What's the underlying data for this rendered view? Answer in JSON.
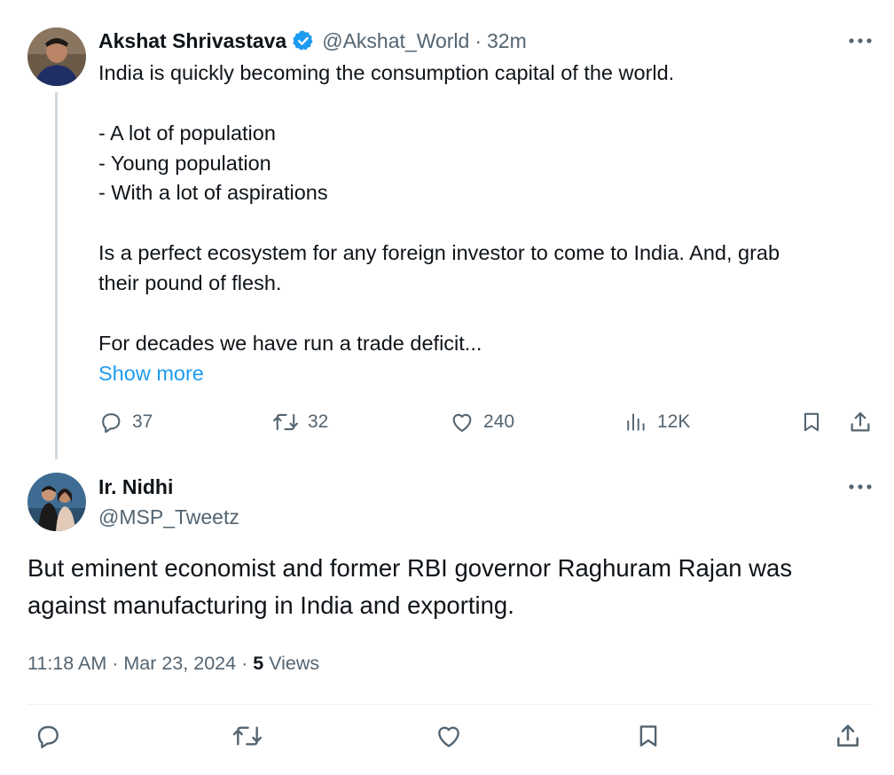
{
  "parent_tweet": {
    "author_name": "Akshat Shrivastava",
    "handle": "@Akshat_World",
    "separator": "·",
    "time": "32m",
    "text_lines": [
      "India is quickly becoming the consumption capital of the world.",
      "",
      "- A lot of population",
      "- Young population",
      "- With a lot of aspirations",
      "",
      "Is a perfect ecosystem for any foreign investor to come to India. And, grab",
      "their pound of flesh.",
      "",
      "For decades we have run a trade deficit..."
    ],
    "show_more": "Show more",
    "stats": {
      "replies": "37",
      "reposts": "32",
      "likes": "240",
      "views": "12K"
    }
  },
  "reply_tweet": {
    "author_name": "Ir. Nidhi",
    "handle": "@MSP_Tweetz",
    "text_lines": [
      "But eminent economist and former RBI governor Raghuram Rajan was",
      "against manufacturing in India and exporting."
    ],
    "time": "11:18 AM",
    "date": "Mar 23, 2024",
    "separator": "·",
    "views_count": "5",
    "views_label": "Views"
  },
  "icons": {
    "more": "more-icon",
    "verified": "verified-badge-icon",
    "reply": "reply-icon",
    "repost": "repost-icon",
    "like": "like-icon",
    "views": "views-icon",
    "bookmark": "bookmark-icon",
    "share": "share-icon"
  },
  "colors": {
    "accent": "#1d9bf0",
    "text": "#0f1419",
    "muted": "#536471",
    "thread_line": "#cfd9de"
  }
}
